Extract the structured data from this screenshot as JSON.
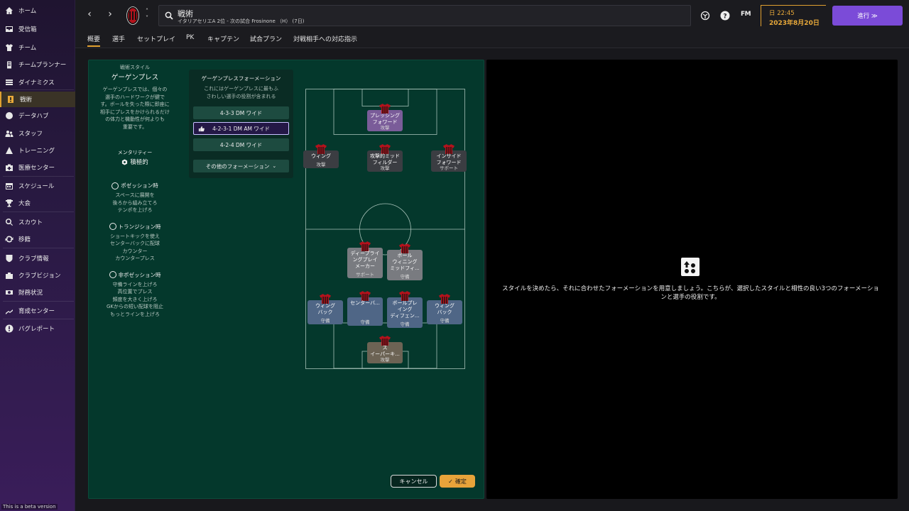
{
  "sidebar": {
    "items": [
      {
        "label": "ホーム",
        "icon": "home-icon"
      },
      {
        "label": "受信箱",
        "icon": "inbox-icon"
      },
      {
        "label": "チーム",
        "icon": "shirt-icon"
      },
      {
        "label": "チームプランナー",
        "icon": "clipboard-icon"
      },
      {
        "label": "ダイナミクス",
        "icon": "dynamics-icon"
      },
      {
        "label": "戦術",
        "icon": "tactics-icon",
        "active": true
      },
      {
        "label": "データハブ",
        "icon": "data-hub-icon"
      },
      {
        "label": "スタッフ",
        "icon": "staff-icon"
      },
      {
        "label": "トレーニング",
        "icon": "training-icon"
      },
      {
        "label": "医療センター",
        "icon": "medical-icon"
      },
      {
        "label": "スケジュール",
        "icon": "calendar-icon"
      },
      {
        "label": "大会",
        "icon": "trophy-icon"
      },
      {
        "label": "スカウト",
        "icon": "scout-icon"
      },
      {
        "label": "移籍",
        "icon": "transfer-icon"
      },
      {
        "label": "クラブ情報",
        "icon": "club-info-icon"
      },
      {
        "label": "クラブビジョン",
        "icon": "club-vision-icon"
      },
      {
        "label": "財務状況",
        "icon": "finance-icon"
      },
      {
        "label": "育成センター",
        "icon": "development-icon"
      },
      {
        "label": "バグレポート",
        "icon": "bug-report-icon"
      }
    ],
    "beta_note": "This is a beta version"
  },
  "header": {
    "title": "戦術",
    "subtitle": "イタリアセリエA 2位 - 次の試合 Frosinone （H） (7日)",
    "time": "日 22:45",
    "date": "2023年8月20日",
    "continue_label": "進行 ≫",
    "fm_label": "FM"
  },
  "tabs": [
    "概要",
    "選手",
    "セットプレイ",
    "PK",
    "キャプテン",
    "試合プラン",
    "対戦相手への対応指示"
  ],
  "style_panel": {
    "caption": "戦術スタイル",
    "name": "ゲーゲンプレス",
    "desc": [
      "ゲーゲンプレスでは、個々の",
      "選手のハードワークが鍵で",
      "す。ボールを失った際に即座に",
      "相手にプレスをかけられるだけ",
      "の体力と機動性が何よりも",
      "重要です。"
    ],
    "mentality_label": "メンタリティー",
    "mentality_value": "積極的",
    "in_possession": {
      "title": "ポゼッション時",
      "lines": [
        "スペースに展開を",
        "後ろから組み立てろ",
        "テンポを上げろ"
      ]
    },
    "transition": {
      "title": "トランジション時",
      "lines": [
        "ショートキックを使え",
        "センターバックに配球",
        "カウンター",
        "カウンタープレス"
      ]
    },
    "out_possession": {
      "title": "非ポゼッション時",
      "lines": [
        "守備ラインを上げろ",
        "高位置でプレス",
        "頻度を大きく上げろ",
        "GKからの短い配球を阻止",
        "もっとラインを上げろ"
      ]
    }
  },
  "formations": {
    "title": "ゲーゲンプレスフォーメーション",
    "desc": [
      "これにはゲーゲンプレスに最もふ",
      "さわしい選手の役割が含まれる"
    ],
    "options": [
      "4-3-3 DM ワイド",
      "4-2-3-1 DM AM ワイド",
      "4-2-4 DM ワイド"
    ],
    "selected": "4-2-3-1 DM AM ワイド",
    "more_label": "その他のフォーメーション"
  },
  "players": [
    {
      "role": "プレッシング\nフォワード",
      "duty": "攻撃",
      "color": "purple"
    },
    {
      "role": "ウィング",
      "duty": "攻撃",
      "color": "gray"
    },
    {
      "role": "攻撃的ミッド\nフィルダー",
      "duty": "攻撃",
      "color": "gray"
    },
    {
      "role": "インサイド\nフォワード",
      "duty": "サポート",
      "color": "gray"
    },
    {
      "role": "ディープライ\nングプレイ\nメーカー",
      "duty": "サポート",
      "color": "light"
    },
    {
      "role": "ボール\nウィニング\nミッドフィ...",
      "duty": "守備",
      "color": "light"
    },
    {
      "role": "ウィング\nバック",
      "duty": "守備",
      "color": "blue"
    },
    {
      "role": "センターバ...",
      "duty": "守備",
      "color": "blue"
    },
    {
      "role": "ボールプレ\nイング\nディフェン...",
      "duty": "守備",
      "color": "blue"
    },
    {
      "role": "ウィング\nバック",
      "duty": "守備",
      "color": "blue"
    },
    {
      "role": "ス\nイーパーキ...",
      "duty": "攻撃",
      "color": "brown"
    }
  ],
  "actions": {
    "cancel": "キャンセル",
    "confirm": "確定"
  },
  "info": {
    "text": "スタイルを決めたら、それに合わせたフォーメーションを用意しましょう。こちらが、選択したスタイルと相性の良い3つのフォーメーションと選手の役割です。"
  },
  "colors": {
    "accent": "#e0a030",
    "continue": "#7b4bd8",
    "pitch": "#04382c",
    "shirt_red": "#b3121c"
  }
}
